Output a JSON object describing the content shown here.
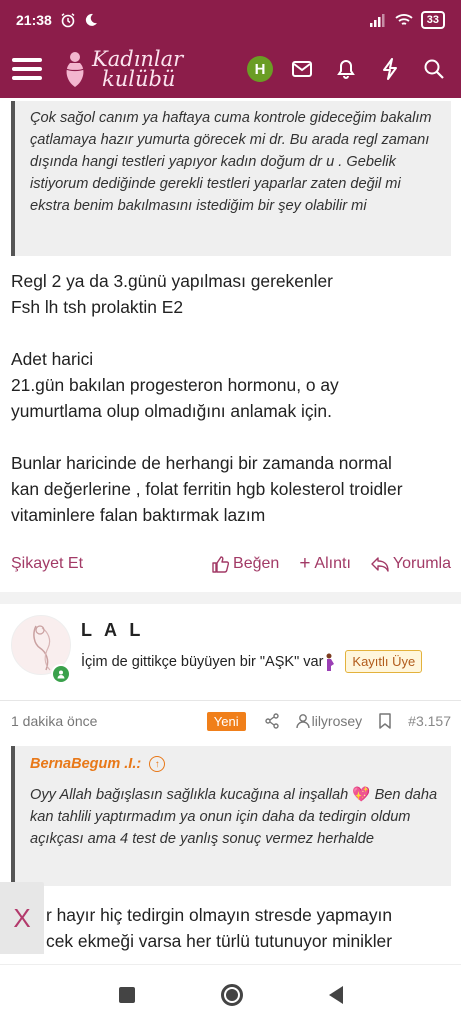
{
  "status": {
    "time": "21:38",
    "battery": "33"
  },
  "header": {
    "logo_line1": "Kadınlar",
    "logo_line2": "kulübü",
    "avatar_letter": "H"
  },
  "post1": {
    "quote": "Çok sağol canım ya haftaya cuma kontrole gideceğim bakalım çatlamaya hazır yumurta görecek mi dr. Bu arada regl zamanı dışında hangi testleri yapıyor kadın doğum dr u . Gebelik istiyorum dediğinde gerekli testleri yaparlar zaten değil mi ekstra benim bakılmasını istediğim bir şey olabilir mi",
    "lines": [
      "Regl 2 ya da 3.günü yapılması gerekenler",
      "Fsh lh tsh prolaktin E2",
      "",
      "Adet harici",
      "21.gün bakılan progesteron hormonu, o ay",
      "yumurtlama olup olmadığını anlamak için.",
      "",
      "Bunlar haricinde de herhangi bir zamanda normal",
      "kan değerlerine , folat ferritin hgb kolesterol troidler",
      "vitaminlere falan baktırmak lazım"
    ],
    "actions": {
      "report": "Şikayet Et",
      "like": "Beğen",
      "quote": "Alıntı",
      "comment": "Yorumla"
    }
  },
  "post2": {
    "username": "L A L",
    "user_title": "İçim de gittikçe büyüyen bir \"AŞK\" var",
    "badge": "Kayıtlı Üye",
    "time": "1 dakika önce",
    "new_label": "Yeni",
    "author_ref": "lilyrosey",
    "post_number": "#3.157",
    "quote_author": "BernaBegum .I.:",
    "quote_part1": "Oyy Allah bağışlasın sağlıkla kucağına al inşallah",
    "quote_part2": "Ben daha kan tahlili yaptırmadım ya onun için daha da tedirgin oldum açıkçası ama 4 test de yanlış sonuç vermez herhalde",
    "body_line1": "r hayır hiç tedirgin olmayın stresde yapmayın",
    "body_line2": "cek ekmeği varsa her türlü tutunuyor minikler"
  },
  "close_label": "X"
}
